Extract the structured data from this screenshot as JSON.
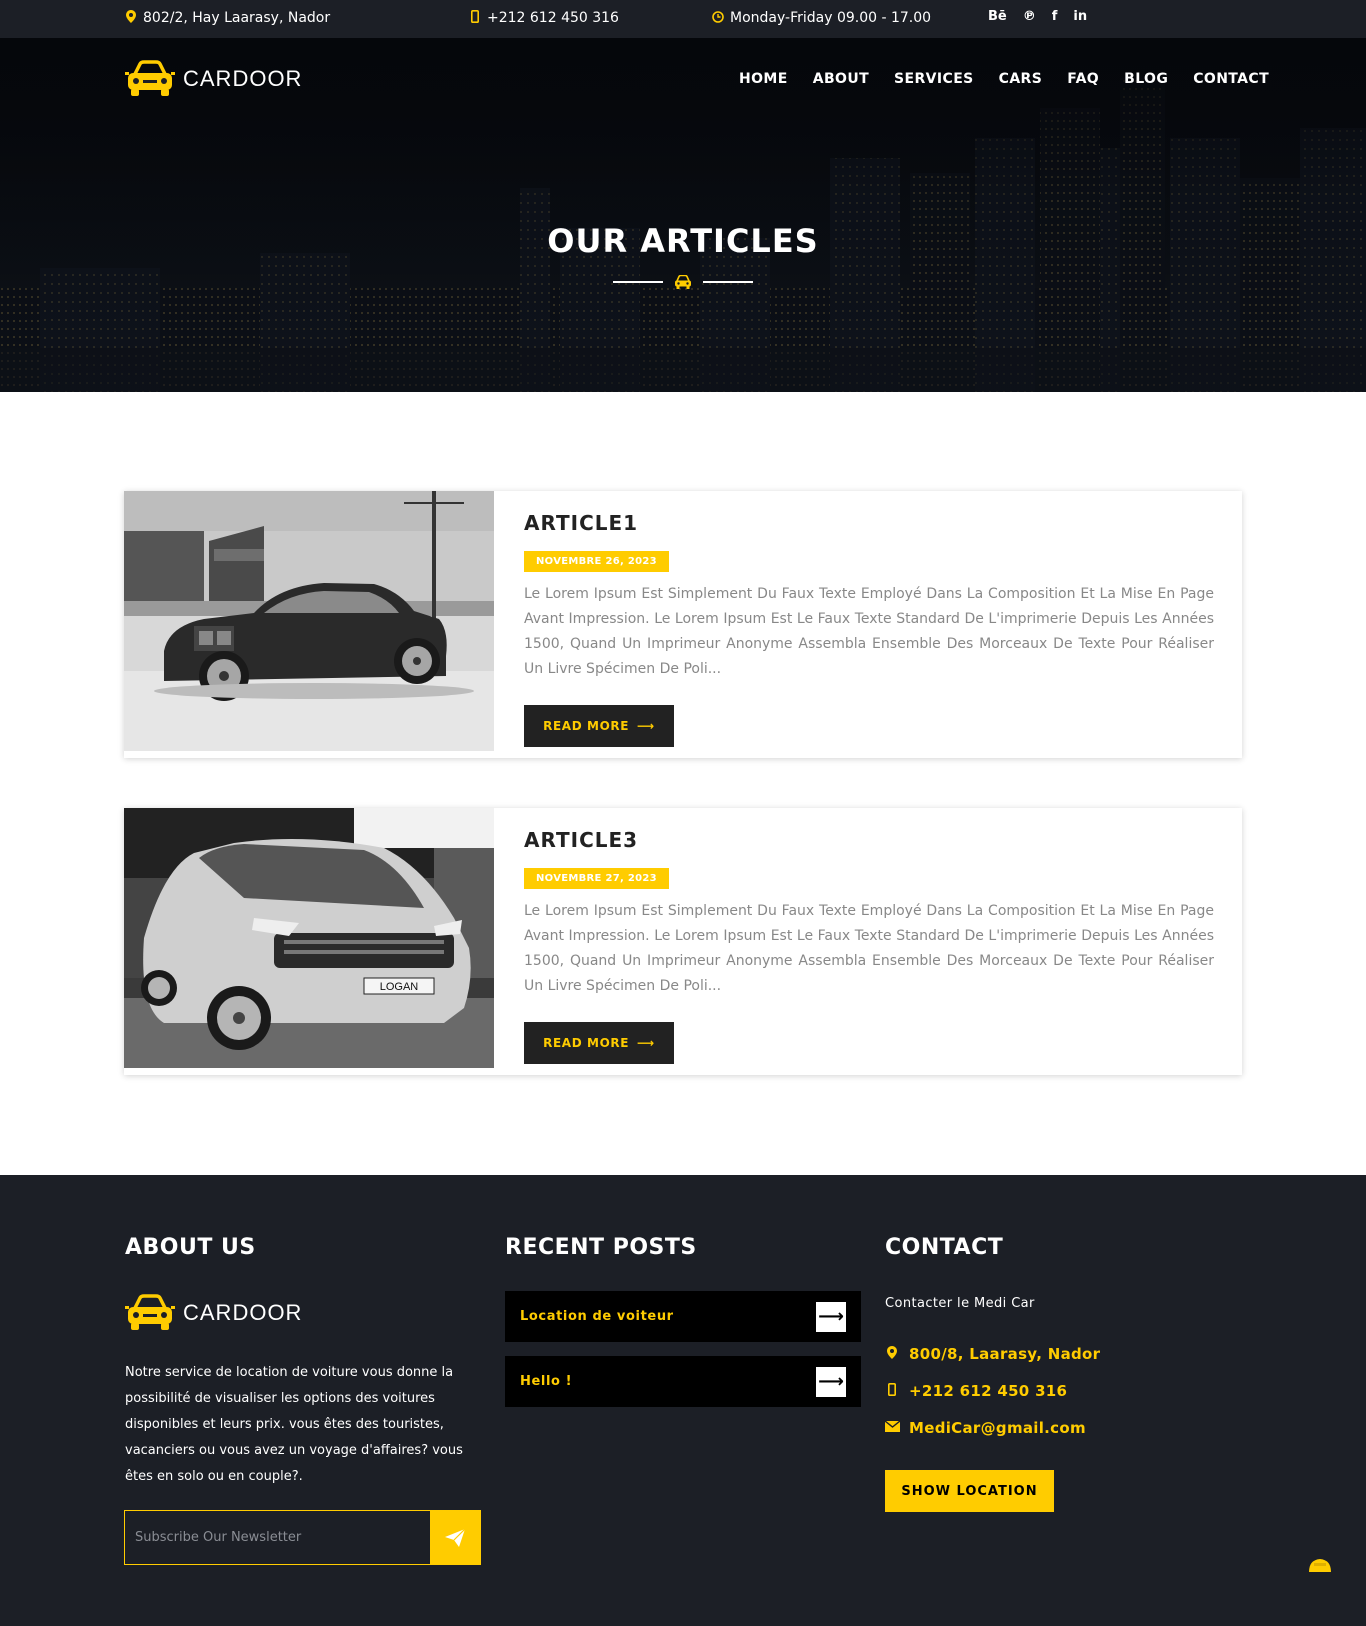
{
  "topbar": {
    "address": "802/2, Hay Laarasy, Nador",
    "phone": "+212 612 450 316",
    "hours": "Monday-Friday 09.00 - 17.00",
    "social": [
      "Bē",
      "℗",
      "f",
      "in"
    ]
  },
  "brand": {
    "name": "CARDOOR"
  },
  "nav": {
    "items": [
      {
        "label": "HOME"
      },
      {
        "label": "ABOUT"
      },
      {
        "label": "SERVICES"
      },
      {
        "label": "CARS"
      },
      {
        "label": "FAQ"
      },
      {
        "label": "BLOG"
      },
      {
        "label": "CONTACT"
      }
    ]
  },
  "hero": {
    "title": "OUR ARTICLES"
  },
  "articles": [
    {
      "title": "ARTICLE1",
      "date": "NOVEMBRE 26, 2023",
      "excerpt": "Le Lorem Ipsum Est Simplement Du Faux Texte Employé Dans La Composition Et La Mise En Page Avant Impression. Le Lorem Ipsum Est Le Faux Texte Standard De L'imprimerie Depuis Les Années 1500, Quand Un Imprimeur Anonyme Assembla Ensemble Des Morceaux De Texte Pour Réaliser Un Livre Spécimen De Poli...",
      "button": "READ MORE"
    },
    {
      "title": "ARTICLE3",
      "date": "NOVEMBRE 27, 2023",
      "excerpt": "Le Lorem Ipsum Est Simplement Du Faux Texte Employé Dans La Composition Et La Mise En Page Avant Impression. Le Lorem Ipsum Est Le Faux Texte Standard De L'imprimerie Depuis Les Années 1500, Quand Un Imprimeur Anonyme Assembla Ensemble Des Morceaux De Texte Pour Réaliser Un Livre Spécimen De Poli...",
      "button": "READ MORE",
      "plate": "LOGAN"
    }
  ],
  "footer": {
    "about": {
      "title": "ABOUT US",
      "text": "Notre service de location de voiture vous donne la possibilité de visualiser les options des voitures disponibles et leurs prix. vous êtes des touristes, vacanciers ou vous avez un voyage d'affaires? vous êtes en solo ou en couple?.",
      "newsletter_placeholder": "Subscribe Our Newsletter"
    },
    "recent": {
      "title": "RECENT POSTS",
      "posts": [
        {
          "title": "Location de voiteur"
        },
        {
          "title": "Hello !"
        }
      ]
    },
    "contact": {
      "title": "CONTACT",
      "subtitle": "Contacter le Medi Car",
      "address": "800/8, Laarasy, Nador",
      "phone": "+212 612 450 316",
      "email": "MediCar@gmail.com",
      "button": "SHOW LOCATION"
    }
  },
  "colors": {
    "accent": "#ffcc00",
    "dark": "#1c1f26",
    "black": "#000000"
  },
  "icons": {
    "address": "map-marker-icon",
    "phone": "mobile-phone-icon",
    "hours": "clock-icon",
    "email": "envelope-icon",
    "send": "paper-plane-icon",
    "arrow": "arrow-right-icon",
    "logo": "car-icon"
  }
}
